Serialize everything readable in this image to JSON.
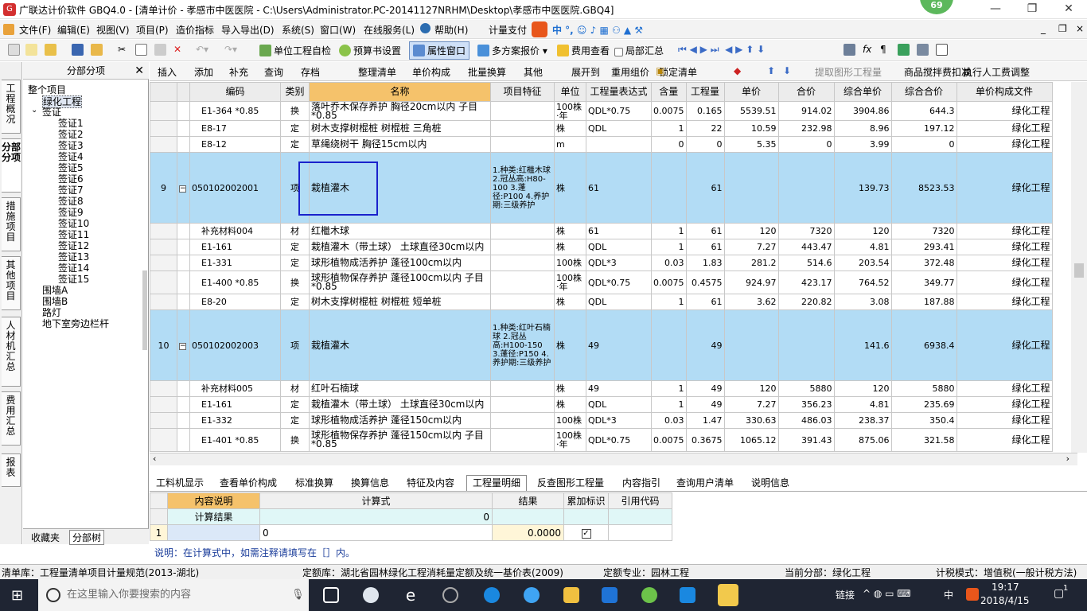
{
  "window": {
    "title": "广联达计价软件 GBQ4.0 - [清单计价 - 孝感市中医医院 - C:\\Users\\Administrator.PC-20141127NRHM\\Desktop\\孝感市中医医院.GBQ4]",
    "badge": "69",
    "minimize": "—",
    "maximize": "❐",
    "close": "✕"
  },
  "menu": [
    "文件(F)",
    "编辑(E)",
    "视图(V)",
    "项目(P)",
    "造价指标",
    "导入导出(D)",
    "系统(S)",
    "窗口(W)",
    "在线服务(L)",
    "帮助(H)",
    "计量支付"
  ],
  "menu_right_controls": [
    "_",
    "❐",
    "×"
  ],
  "toolbar1": {
    "check": "单位工程自检",
    "budget": "预算书设置",
    "property": "属性窗口",
    "multi": "多方案报价",
    "cost": "费用查看",
    "partial": "局部汇总"
  },
  "toolbar2": [
    "插入",
    "添加",
    "补充",
    "查询",
    "存档",
    "整理清单",
    "单价构成",
    "批量换算",
    "其他",
    "展开到",
    "重用组价",
    "锁定清单",
    "提取图形工程量",
    "商品搅拌费扣减",
    "执行人工费调整"
  ],
  "leftnav": [
    "工程概况",
    "分部分项",
    "措施项目",
    "其他项目",
    "人材机汇总",
    "费用汇总",
    "报表"
  ],
  "tree": {
    "header": "分部分项",
    "close": "✕",
    "root": "整个项目",
    "items": [
      {
        "label": "绿化工程",
        "indent": 1
      },
      {
        "label": "签证",
        "indent": 1
      },
      {
        "label": "签证1",
        "indent": 2
      },
      {
        "label": "签证2",
        "indent": 2
      },
      {
        "label": "签证3",
        "indent": 2
      },
      {
        "label": "签证4",
        "indent": 2
      },
      {
        "label": "签证5",
        "indent": 2
      },
      {
        "label": "签证6",
        "indent": 2
      },
      {
        "label": "签证7",
        "indent": 2
      },
      {
        "label": "签证8",
        "indent": 2
      },
      {
        "label": "签证9",
        "indent": 2
      },
      {
        "label": "签证10",
        "indent": 2
      },
      {
        "label": "签证11",
        "indent": 2
      },
      {
        "label": "签证12",
        "indent": 2
      },
      {
        "label": "签证13",
        "indent": 2
      },
      {
        "label": "签证14",
        "indent": 2
      },
      {
        "label": "签证15",
        "indent": 2
      },
      {
        "label": "围墙A",
        "indent": 1
      },
      {
        "label": "围墙B",
        "indent": 1
      },
      {
        "label": "路灯",
        "indent": 1
      },
      {
        "label": "地下室旁边栏杆",
        "indent": 1
      }
    ],
    "tabs": [
      "收藏夹",
      "分部树"
    ]
  },
  "grid": {
    "headers": [
      "编码",
      "类别",
      "名称",
      "项目特征",
      "单位",
      "工程量表达式",
      "含量",
      "工程量",
      "单价",
      "合价",
      "综合单价",
      "综合合价",
      "单价构成文件"
    ],
    "rows": [
      {
        "no": "",
        "code": "E1-364 *0.85",
        "type": "换",
        "name": "落叶乔木保存养护 胸径20cm以内 子目*0.85",
        "feat": "",
        "unit": "100株·年",
        "expr": "QDL*0.75",
        "ratio": "0.0075",
        "qty": "0.165",
        "price": "5539.51",
        "total": "914.02",
        "uprice": "3904.86",
        "utotal": "644.3",
        "file": "绿化工程",
        "hl": false,
        "h": 24
      },
      {
        "no": "",
        "code": "E8-17",
        "type": "定",
        "name": "树木支撑树棍桩 树棍桩 三角桩",
        "feat": "",
        "unit": "株",
        "expr": "QDL",
        "ratio": "1",
        "qty": "22",
        "price": "10.59",
        "total": "232.98",
        "uprice": "8.96",
        "utotal": "197.12",
        "file": "绿化工程",
        "hl": false,
        "h": 20
      },
      {
        "no": "",
        "code": "E8-12",
        "type": "定",
        "name": "草绳绕树干 胸径15cm以内",
        "feat": "",
        "unit": "m",
        "expr": "",
        "ratio": "0",
        "qty": "0",
        "price": "5.35",
        "total": "0",
        "uprice": "3.99",
        "utotal": "0",
        "file": "绿化工程",
        "hl": false,
        "h": 20
      },
      {
        "no": "9",
        "code": "050102002001",
        "type": "项",
        "name": "栽植灌木",
        "feat": "1.种类:红檵木球 2.冠丛高:H80-100 3.蓬径:P100 4.养护期:三级养护",
        "unit": "株",
        "expr": "61",
        "ratio": "",
        "qty": "61",
        "price": "",
        "total": "",
        "uprice": "139.73",
        "utotal": "8523.53",
        "file": "绿化工程",
        "hl": true,
        "h": 89
      },
      {
        "no": "",
        "code": "补充材料004",
        "type": "材",
        "name": "红檵木球",
        "feat": "",
        "unit": "株",
        "expr": "61",
        "ratio": "1",
        "qty": "61",
        "price": "120",
        "total": "7320",
        "uprice": "120",
        "utotal": "7320",
        "file": "绿化工程",
        "hl": false,
        "h": 20
      },
      {
        "no": "",
        "code": "E1-161",
        "type": "定",
        "name": "栽植灌木（带土球） 土球直径30cm以内",
        "feat": "",
        "unit": "株",
        "expr": "QDL",
        "ratio": "1",
        "qty": "61",
        "price": "7.27",
        "total": "443.47",
        "uprice": "4.81",
        "utotal": "293.41",
        "file": "绿化工程",
        "hl": false,
        "h": 20
      },
      {
        "no": "",
        "code": "E1-331",
        "type": "定",
        "name": "球形植物成活养护 蓬径100cm以内",
        "feat": "",
        "unit": "100株",
        "expr": "QDL*3",
        "ratio": "0.03",
        "qty": "1.83",
        "price": "281.2",
        "total": "514.6",
        "uprice": "203.54",
        "utotal": "372.48",
        "file": "绿化工程",
        "hl": false,
        "h": 20
      },
      {
        "no": "",
        "code": "E1-400 *0.85",
        "type": "换",
        "name": "球形植物保存养护 蓬径100cm以内 子目*0.85",
        "feat": "",
        "unit": "100株·年",
        "expr": "QDL*0.75",
        "ratio": "0.0075",
        "qty": "0.4575",
        "price": "924.97",
        "total": "423.17",
        "uprice": "764.52",
        "utotal": "349.77",
        "file": "绿化工程",
        "hl": false,
        "h": 29
      },
      {
        "no": "",
        "code": "E8-20",
        "type": "定",
        "name": "树木支撑树棍桩 树棍桩 短单桩",
        "feat": "",
        "unit": "株",
        "expr": "QDL",
        "ratio": "1",
        "qty": "61",
        "price": "3.62",
        "total": "220.82",
        "uprice": "3.08",
        "utotal": "187.88",
        "file": "绿化工程",
        "hl": false,
        "h": 20
      },
      {
        "no": "10",
        "code": "050102002003",
        "type": "项",
        "name": "栽植灌木",
        "feat": "1.种类:红叶石楠球 2.冠丛高:H100-150 3.蓬径:P150 4.养护期:三级养护",
        "unit": "株",
        "expr": "49",
        "ratio": "",
        "qty": "49",
        "price": "",
        "total": "",
        "uprice": "141.6",
        "utotal": "6938.4",
        "file": "绿化工程",
        "hl": true,
        "h": 89
      },
      {
        "no": "",
        "code": "补充材料005",
        "type": "材",
        "name": "红叶石楠球",
        "feat": "",
        "unit": "株",
        "expr": "49",
        "ratio": "1",
        "qty": "49",
        "price": "120",
        "total": "5880",
        "uprice": "120",
        "utotal": "5880",
        "file": "绿化工程",
        "hl": false,
        "h": 20
      },
      {
        "no": "",
        "code": "E1-161",
        "type": "定",
        "name": "栽植灌木（带土球） 土球直径30cm以内",
        "feat": "",
        "unit": "株",
        "expr": "QDL",
        "ratio": "1",
        "qty": "49",
        "price": "7.27",
        "total": "356.23",
        "uprice": "4.81",
        "utotal": "235.69",
        "file": "绿化工程",
        "hl": false,
        "h": 20
      },
      {
        "no": "",
        "code": "E1-332",
        "type": "定",
        "name": "球形植物成活养护 蓬径150cm以内",
        "feat": "",
        "unit": "100株",
        "expr": "QDL*3",
        "ratio": "0.03",
        "qty": "1.47",
        "price": "330.63",
        "total": "486.03",
        "uprice": "238.37",
        "utotal": "350.4",
        "file": "绿化工程",
        "hl": false,
        "h": 20
      },
      {
        "no": "",
        "code": "E1-401 *0.85",
        "type": "换",
        "name": "球形植物保存养护 蓬径150cm以内 子目*0.85",
        "feat": "",
        "unit": "100株·年",
        "expr": "QDL*0.75",
        "ratio": "0.0075",
        "qty": "0.3675",
        "price": "1065.12",
        "total": "391.43",
        "uprice": "875.06",
        "utotal": "321.58",
        "file": "绿化工程",
        "hl": false,
        "h": 29
      }
    ]
  },
  "bottom_tabs": [
    "工料机显示",
    "查看单价构成",
    "标准换算",
    "换算信息",
    "特征及内容",
    "工程量明细",
    "反查图形工程量",
    "内容指引",
    "查询用户清单",
    "说明信息"
  ],
  "calc": {
    "headers": [
      "内容说明",
      "计算式",
      "结果",
      "累加标识",
      "引用代码"
    ],
    "summary_label": "计算结果",
    "summary_value": "0",
    "row_no": "1",
    "row_expr": "0",
    "row_result": "0.0000"
  },
  "note": "说明：在计算式中，如需注释请填写在［］内。",
  "status": {
    "qdk": "清单库：工程量清单项目计量规范(2013-湖北)",
    "dek": "定额库：湖北省园林绿化工程消耗量定额及统一基价表(2009)",
    "dezy": "定额专业：园林工程",
    "dqfb": "当前分部：绿化工程",
    "jsms": "计税模式：增值税(一般计税方法)"
  },
  "taskbar": {
    "search_placeholder": "在这里输入你要搜索的内容",
    "tray": "链接",
    "ime": "中",
    "time": "19:17",
    "date": "2018/4/15",
    "notify": "1"
  },
  "colors": {
    "highlight": "#b2dcf5",
    "header_name": "#f5c26b",
    "taskbar": "#1f2533"
  }
}
